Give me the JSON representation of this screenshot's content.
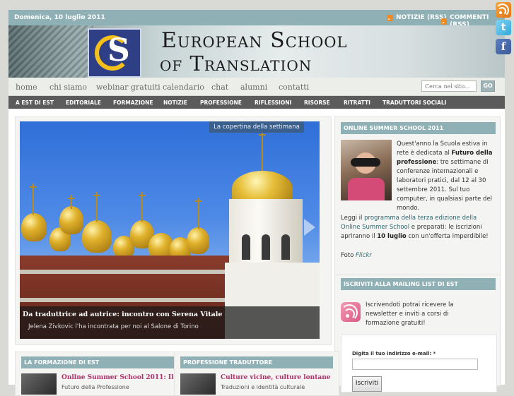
{
  "topbar": {
    "date": "Domenica, 10 luglio 2011",
    "rss_news": "NOTIZIE (RSS)",
    "rss_comments": "COMMENTI (RSS)"
  },
  "banner": {
    "line1": "European School",
    "line2": "of Translation"
  },
  "nav": {
    "items": [
      "home",
      "chi siamo",
      "webinar gratuiti",
      "calendario",
      "chat",
      "alumni",
      "contatti"
    ],
    "search_placeholder": "Cerca nel sito...",
    "go_label": "GO"
  },
  "categories": [
    "A EST DI EST",
    "EDITORIALE",
    "FORMAZIONE",
    "NOTIZIE",
    "PROFESSIONE",
    "RIFLESSIONI",
    "RISORSE",
    "RITRATTI",
    "TRADUTTORI SOCIALI"
  ],
  "feature": {
    "label": "La copertina della settimana",
    "title": "Da traduttrice ad autrice: incontro con Serena Vitale",
    "subtitle": "Jelena Zivkovic l'ha incontrata per noi al Salone di Torino"
  },
  "summer_school": {
    "heading": "ONLINE SUMMER SCHOOL 2011",
    "p1_a": "Quest'anno la Scuola estiva in rete è dedicata al ",
    "p1_b": "Futuro della professione",
    "p1_c": ": tre settimane di conferenze internazionali e laboratori pratici, dal 12 al 30 settembre 2011. Sul tuo computer, in qualsiasi parte del mondo.",
    "p2_a": "Leggi il ",
    "p2_link": "programma della terza edizione della Online Summer School",
    "p2_b": " e preparati: le iscrizioni apriranno il ",
    "p2_date": "10 luglio",
    "p2_c": " con un'offerta imperdibile!",
    "photo_label": "Foto ",
    "photo_credit": "Flickr"
  },
  "mailing": {
    "heading": "ISCRIVITI ALLA MAILING LIST DI EST",
    "text": "Iscrivendoti potrai ricevere la newsletter e inviti a corsi di formazione gratuiti!",
    "email_label": "Digita il tuo indirizzo e-mail: *",
    "submit": "Iscriviti"
  },
  "bottom": [
    {
      "heading": "LA FORMAZIONE DI EST",
      "title": "Online Summer School 2011: Il",
      "sub": "Futuro della Professione"
    },
    {
      "heading": "PROFESSIONE TRADUTTORE",
      "title": "Culture vicine, culture lontane",
      "sub": "Traduzioni e identità culturale"
    }
  ],
  "colors": {
    "accent": "#8fb0b5",
    "category_bar": "#5b5b5b",
    "link": "#2b6a74",
    "title_pink": "#b0306b"
  }
}
